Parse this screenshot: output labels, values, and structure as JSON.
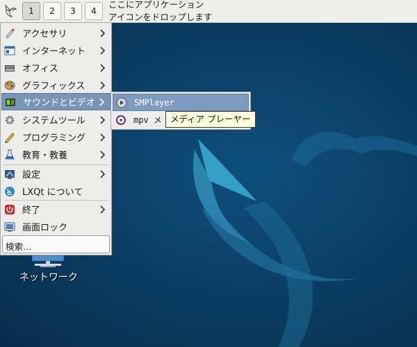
{
  "panel": {
    "desktop_buttons": [
      "1",
      "2",
      "3",
      "4"
    ],
    "active_desktop": "1",
    "quicklaunch_hint_line1": "ここにアプリケーション",
    "quicklaunch_hint_line2": "アイコンをドロップします"
  },
  "main_menu": {
    "items": [
      {
        "label": "アクセサリ",
        "icon": "accessories-icon"
      },
      {
        "label": "インターネット",
        "icon": "internet-icon"
      },
      {
        "label": "オフィス",
        "icon": "office-icon"
      },
      {
        "label": "グラフィックス",
        "icon": "graphics-icon"
      },
      {
        "label": "サウンドとビデオ",
        "icon": "multimedia-icon"
      },
      {
        "label": "システムツール",
        "icon": "system-tools-icon"
      },
      {
        "label": "プログラミング",
        "icon": "programming-icon"
      },
      {
        "label": "教育・教養",
        "icon": "education-icon"
      },
      {
        "label": "設定",
        "icon": "settings-icon"
      },
      {
        "label": "LXQt について",
        "icon": "lxqt-icon"
      },
      {
        "label": "終了",
        "icon": "power-icon"
      },
      {
        "label": "画面ロック",
        "icon": "lock-screen-icon"
      }
    ],
    "search_placeholder": "検索..."
  },
  "submenu": {
    "items": [
      {
        "label": "SMPlayer",
        "icon": "smplayer-icon"
      },
      {
        "label": "mpv メディア プレーヤー",
        "icon": "mpv-icon"
      }
    ],
    "visible_item2_label": "mpv メ"
  },
  "tooltip": {
    "text": "メディア プレーヤー"
  },
  "desktop_icons": [
    {
      "label": "ネットワーク",
      "icon": "network-icon"
    }
  ],
  "colors": {
    "highlight": "#7895b6",
    "desktop_bg": "#0b3f66",
    "tooltip_bg": "#ffffdc"
  }
}
